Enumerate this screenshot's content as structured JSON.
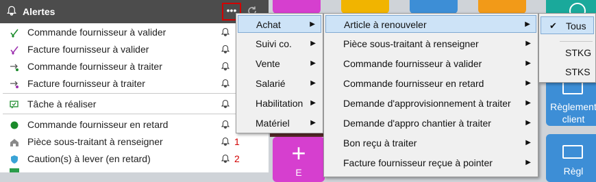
{
  "alerts": {
    "title": "Alertes",
    "more_label": "•••",
    "items": [
      {
        "label": "Commande fournisseur à valider",
        "icon": "check-green-icon",
        "count": ""
      },
      {
        "label": "Facture fournisseur à valider",
        "icon": "check-purple-icon",
        "count": ""
      },
      {
        "label": "Commande fournisseur à traiter",
        "icon": "arrow-green-icon",
        "count": ""
      },
      {
        "label": "Facture fournisseur à traiter",
        "icon": "arrow-purple-icon",
        "count": ""
      },
      {
        "label": "Tâche à réaliser",
        "icon": "task-icon",
        "count": ""
      },
      {
        "label": "Commande fournisseur en retard",
        "icon": "dot-green-icon",
        "count": ""
      },
      {
        "label": "Pièce sous-traitant à renseigner",
        "icon": "house-icon",
        "count": "1"
      },
      {
        "label": "Caution(s) à lever (en retard)",
        "icon": "shield-icon",
        "count": "2"
      }
    ]
  },
  "menu1": {
    "items": [
      {
        "label": "Achat"
      },
      {
        "label": "Suivi co."
      },
      {
        "label": "Vente"
      },
      {
        "label": "Salarié"
      },
      {
        "label": "Habilitation"
      },
      {
        "label": "Matériel"
      }
    ]
  },
  "menu2": {
    "items": [
      {
        "label": "Article à renouveler"
      },
      {
        "label": "Pièce sous-traitant à renseigner"
      },
      {
        "label": "Commande fournisseur à valider"
      },
      {
        "label": "Commande fournisseur en retard"
      },
      {
        "label": "Demande d'approvisionnement à traiter"
      },
      {
        "label": "Demande d'appro chantier à traiter"
      },
      {
        "label": "Bon reçu à traiter"
      },
      {
        "label": "Facture fournisseur reçue à pointer"
      }
    ]
  },
  "menu3": {
    "items": [
      {
        "label": "Tous",
        "checked": "✔"
      },
      {
        "label": "STKG"
      },
      {
        "label": "STKS"
      }
    ]
  },
  "tiles": {
    "reglement_label_1": "Règlement",
    "reglement_label_2": "client",
    "plus_label": "+",
    "bottom_left_label": "E",
    "bottom_right_label": "Règl"
  },
  "colors": {
    "header_bg": "#4c4c4c",
    "highlight_border": "#d20000",
    "selected_item_bg": "#cde3f7",
    "tile_blue": "#3d8ed6",
    "tile_magenta": "#d63fcf",
    "tile_yellow": "#f1b400",
    "tile_teal": "#1aa99b"
  }
}
